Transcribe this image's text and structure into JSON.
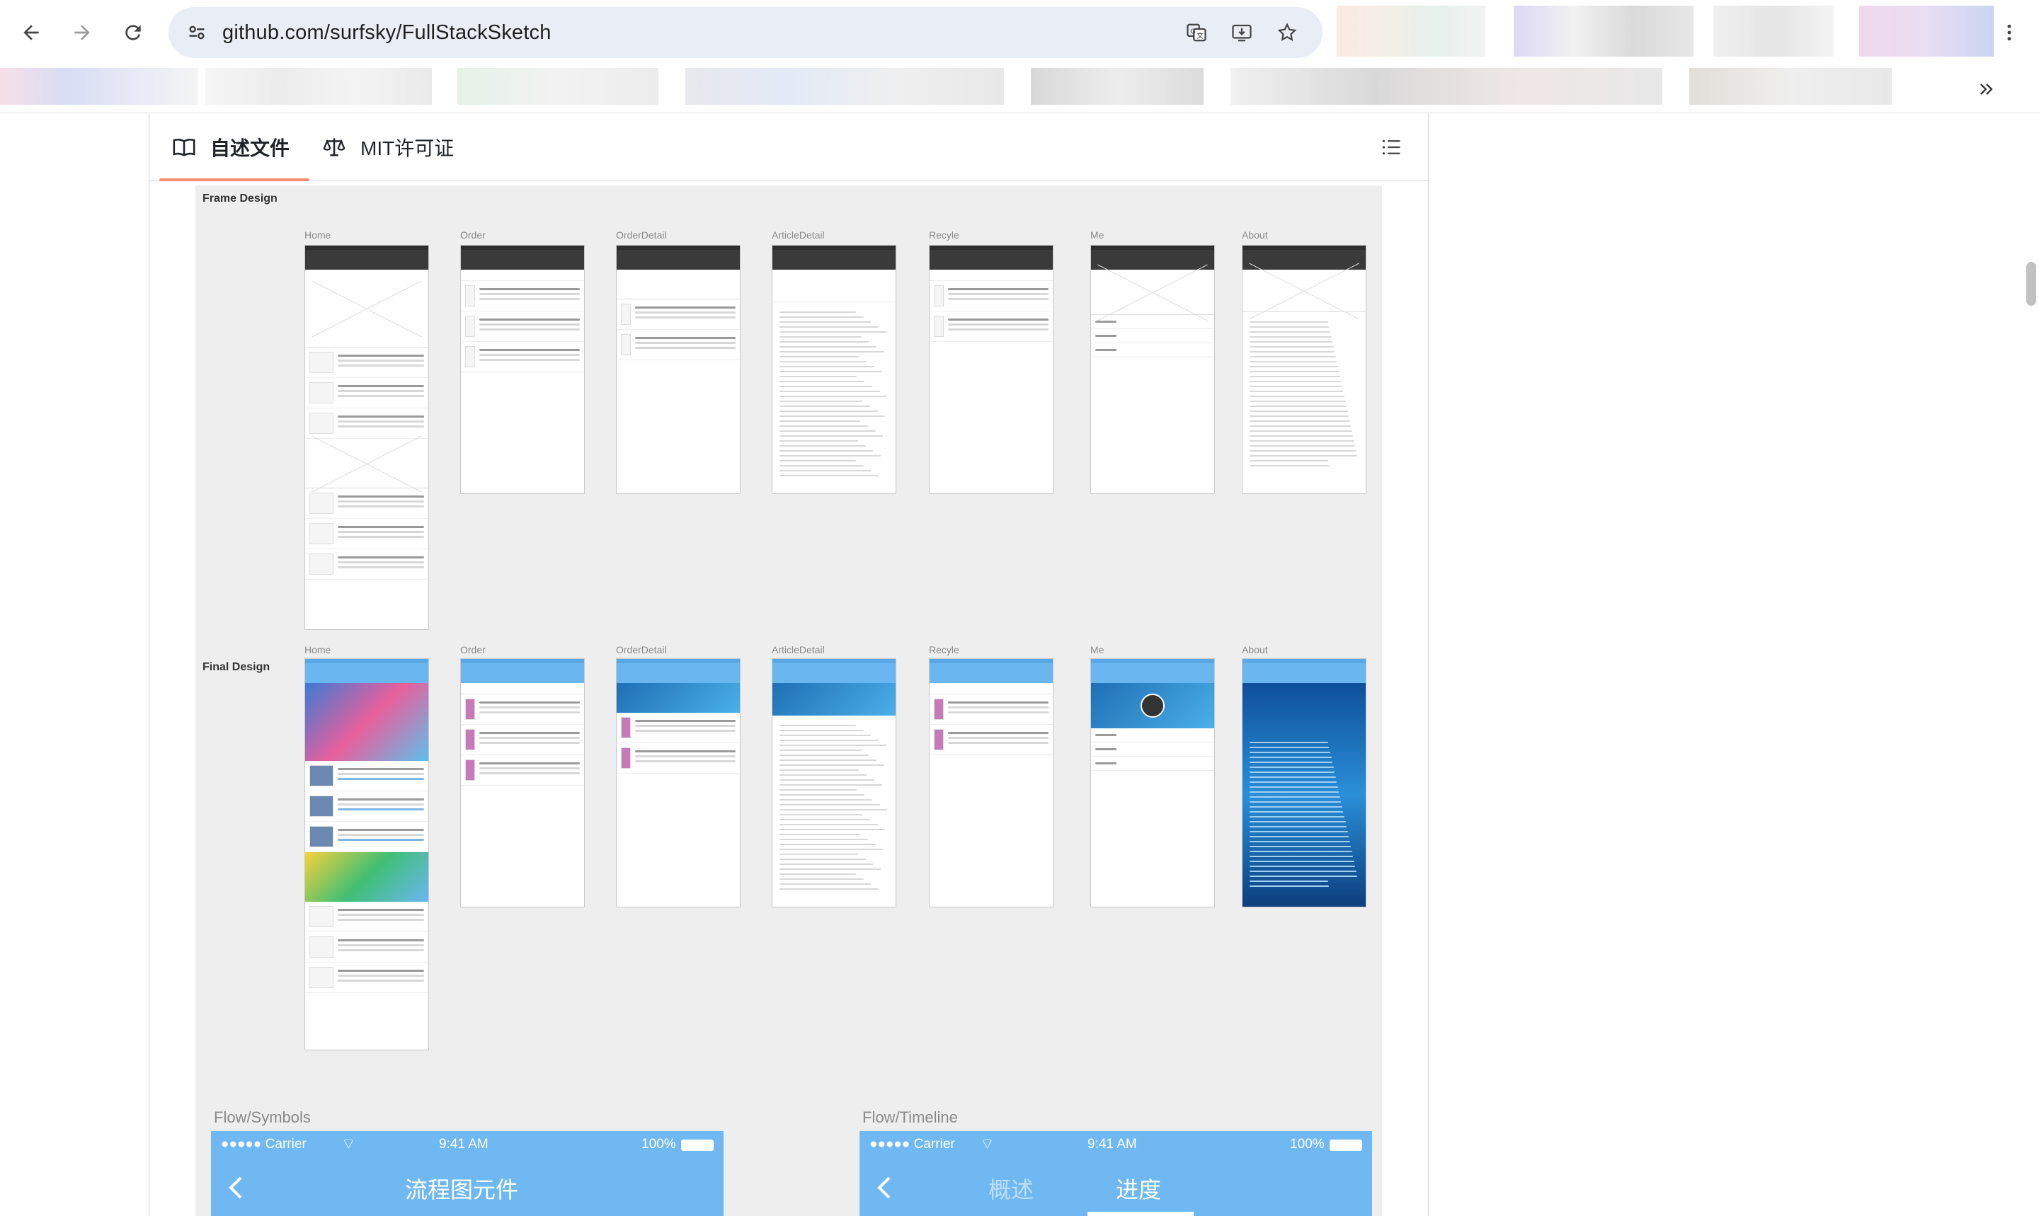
{
  "browser": {
    "url": "github.com/surfsky/FullStackSketch"
  },
  "readme": {
    "tabs": [
      {
        "label": "自述文件",
        "icon": "book-icon",
        "active": true
      },
      {
        "label": "MIT许可证",
        "icon": "law-scale-icon",
        "active": false
      }
    ],
    "toc_icon": "list-unordered-icon"
  },
  "design": {
    "frame_label": "Frame Design",
    "final_label": "Final Design",
    "screens": [
      "Home",
      "Order",
      "OrderDetail",
      "ArticleDetail",
      "Recyle",
      "Me",
      "About"
    ],
    "flows": [
      {
        "label": "Flow/Symbols",
        "status": {
          "carrier": "●●●●● Carrier",
          "time": "9:41 AM",
          "battery": "100%"
        },
        "title": "流程图元件",
        "tabs": []
      },
      {
        "label": "Flow/Timeline",
        "status": {
          "carrier": "●●●●● Carrier",
          "time": "9:41 AM",
          "battery": "100%"
        },
        "title": "",
        "tabs": [
          "概述",
          "进度"
        ]
      }
    ]
  },
  "colors": {
    "tab_underline": "#fd8c73",
    "flow_blue": "#6fb8f2",
    "omnibox": "#e9eef6"
  }
}
